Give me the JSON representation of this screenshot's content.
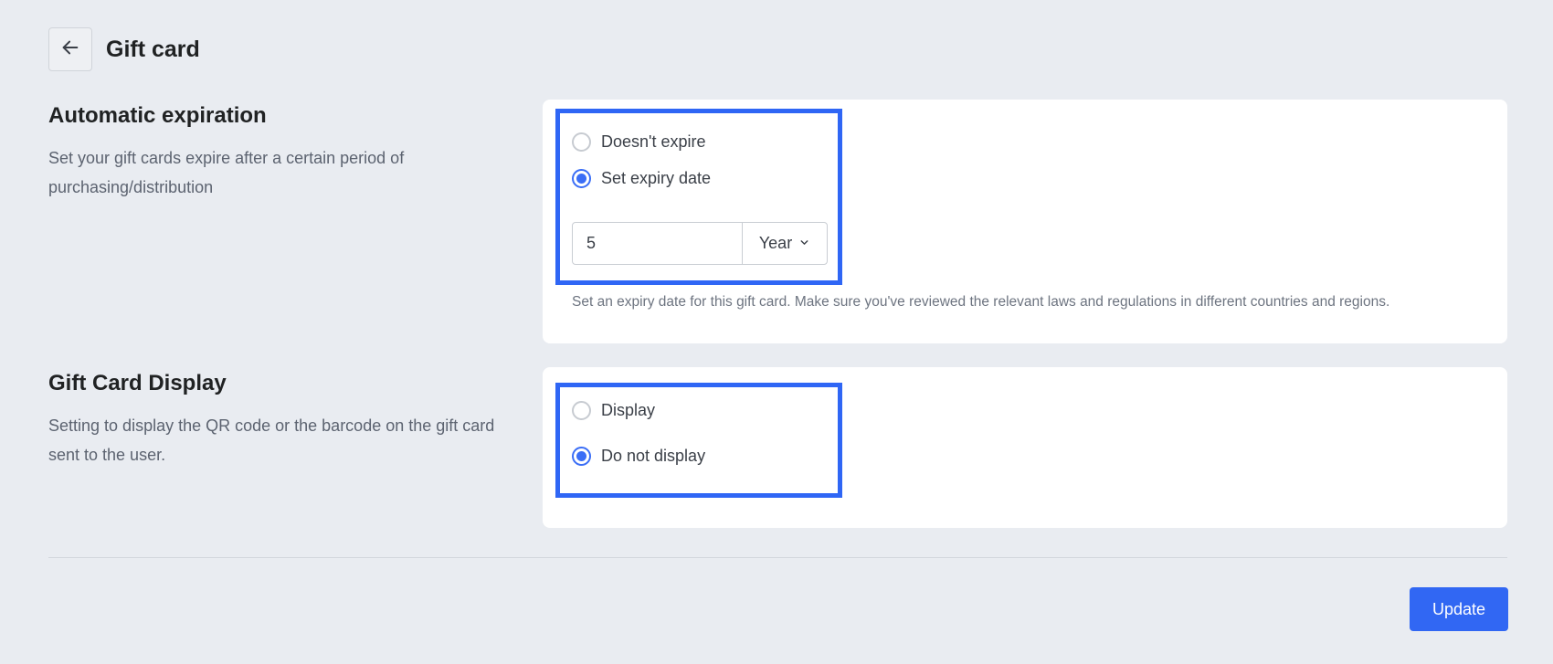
{
  "header": {
    "back_icon": "arrow-left-icon",
    "title": "Gift card"
  },
  "expiration": {
    "title": "Automatic expiration",
    "description": "Set your gift cards expire after a certain period of purchasing/distribution",
    "options": [
      {
        "label": "Doesn't expire",
        "checked": false
      },
      {
        "label": "Set expiry date",
        "checked": true
      }
    ],
    "amount": "5",
    "unit": "Year",
    "help": "Set an expiry date for this gift card. Make sure you've reviewed the relevant laws and regulations in different countries and regions."
  },
  "display": {
    "title": "Gift Card Display",
    "description": "Setting to display the QR code or the barcode on the gift card sent to the user.",
    "options": [
      {
        "label": "Display",
        "checked": false
      },
      {
        "label": "Do not display",
        "checked": true
      }
    ]
  },
  "footer": {
    "update_label": "Update"
  },
  "colors": {
    "accent": "#3167f3",
    "highlight": "#2f66f5",
    "background": "#e9ecf1"
  }
}
